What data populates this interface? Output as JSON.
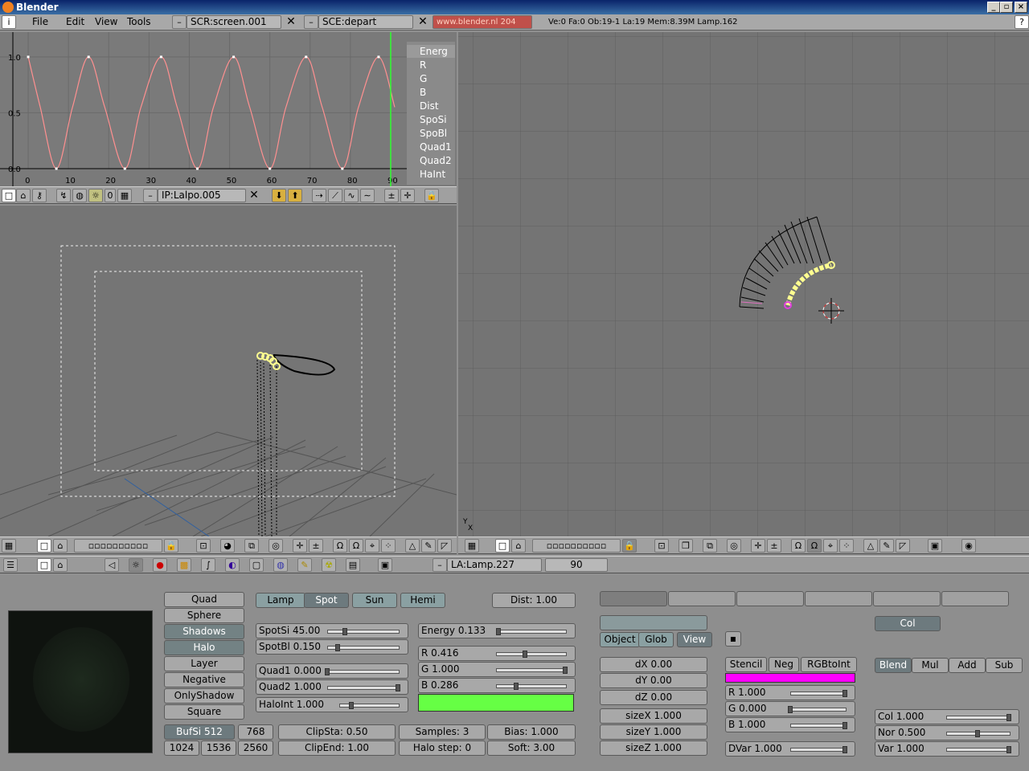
{
  "window": {
    "title": "Blender"
  },
  "topbar": {
    "menus": [
      "File",
      "Edit",
      "View",
      "Tools"
    ],
    "screen": "SCR:screen.001",
    "scene": "SCE:depart",
    "url": "www.blender.nl  204",
    "stats": "Ve:0 Fa:0  Ob:19-1 La:19  Mem:8.39M  Lamp.162"
  },
  "ipo": {
    "channels": [
      "Energ",
      "R",
      "G",
      "B",
      "Dist",
      "SpoSi",
      "SpoBl",
      "Quad1",
      "Quad2",
      "HaInt"
    ],
    "active_channel": "Energ",
    "header_frame": "0",
    "block": "IP:Lalpo.005",
    "xticks": [
      "0",
      "10",
      "20",
      "30",
      "40",
      "50",
      "60",
      "70",
      "80",
      "90"
    ],
    "yticks": [
      "1.0",
      "0.5",
      "0.0"
    ]
  },
  "chart_data": {
    "type": "line",
    "x": [
      0,
      3,
      7,
      11,
      15,
      19,
      24,
      28,
      33,
      37,
      42,
      46,
      51,
      55,
      60,
      64,
      69,
      73,
      78,
      82,
      87,
      91
    ],
    "series": [
      {
        "values": [
          1.0,
          0.55,
          0,
          0.55,
          1.0,
          0.55,
          0,
          0.55,
          1.0,
          0.55,
          0,
          0.55,
          1.0,
          0.55,
          0,
          0.55,
          1.0,
          0.55,
          0,
          0.55,
          1.0,
          0.55
        ]
      }
    ],
    "xlim": [
      -7,
      94
    ],
    "ylim": [
      0,
      1.15
    ],
    "current_frame": 90,
    "grid": true
  },
  "view3d": {
    "axis": "Y\nX"
  },
  "buttons_header": {
    "lamp_name": "LA:Lamp.227",
    "frame": "90"
  },
  "lamp": {
    "modes": [
      "Quad",
      "Sphere",
      "Shadows",
      "Halo",
      "Layer",
      "Negative",
      "OnlyShadow",
      "Square"
    ],
    "modes_active": [
      "Shadows",
      "Halo"
    ],
    "types": [
      "Lamp",
      "Spot",
      "Sun",
      "Hemi"
    ],
    "type_active": "Spot",
    "dist": "Dist: 1.00",
    "spotsi": {
      "label": "SpotSi 45.00",
      "value": 0.25
    },
    "spotbl": {
      "label": "SpotBl 0.150",
      "value": 0.15
    },
    "energy": {
      "label": "Energy 0.133",
      "value": 0.03
    },
    "r": {
      "label": "R 0.416",
      "value": 0.42
    },
    "g": {
      "label": "G 1.000",
      "value": 1.0
    },
    "b": {
      "label": "B 0.286",
      "value": 0.29
    },
    "quad1": {
      "label": "Quad1 0.000",
      "value": 0.0
    },
    "quad2": {
      "label": "Quad2 1.000",
      "value": 1.0
    },
    "haloint": {
      "label": "HaloInt 1.000",
      "value": 0.2
    },
    "lamp_color": "#66ff44",
    "bufsi": "BufSi 512",
    "buf": [
      "768",
      "1024",
      "1536",
      "2560"
    ],
    "clipsta": "ClipSta: 0.50",
    "clipend": "ClipEnd: 1.00",
    "samples": "Samples: 3",
    "halostep": "Halo step: 0",
    "bias": "Bias: 1.000",
    "soft": "Soft: 3.00"
  },
  "texture": {
    "coords": [
      "Object",
      "Glob",
      "View"
    ],
    "coords_active": "View",
    "offsets": [
      "dX 0.00",
      "dY 0.00",
      "dZ 0.00"
    ],
    "sizes": [
      "sizeX 1.000",
      "sizeY 1.000",
      "sizeZ 1.000"
    ],
    "flags": [
      "Stencil",
      "Neg",
      "RGBtoInt"
    ],
    "tex_color": "#ff00ff",
    "tr": {
      "label": "R 1.000",
      "value": 1.0
    },
    "tg": {
      "label": "G 0.000",
      "value": 0.0
    },
    "tb": {
      "label": "B 1.000",
      "value": 1.0
    },
    "dvar": {
      "label": "DVar 1.000",
      "value": 1.0
    },
    "mapto": "Col",
    "blend": [
      "Blend",
      "Mul",
      "Add",
      "Sub"
    ],
    "blend_active": "Blend",
    "col": {
      "label": "Col 1.000",
      "value": 1.0
    },
    "nor": {
      "label": "Nor 0.500",
      "value": 0.5
    },
    "var": {
      "label": "Var 1.000",
      "value": 1.0
    }
  }
}
